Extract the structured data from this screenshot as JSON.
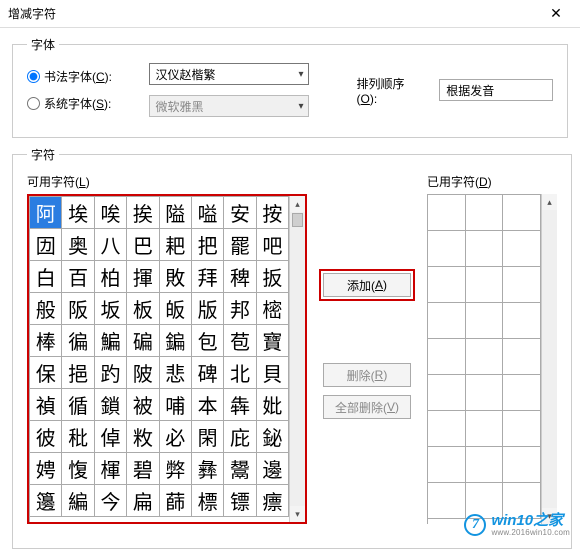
{
  "window": {
    "title": "增减字符",
    "close": "✕"
  },
  "font_group": {
    "legend": "字体",
    "calligraphy": {
      "label_pre": "书法字体(",
      "label_key": "C",
      "label_post": "):"
    },
    "system": {
      "label_pre": "系统字体(",
      "label_key": "S",
      "label_post": "):"
    },
    "calligraphy_value": "汉仪赵楷繁",
    "system_value": "微软雅黑",
    "sort_label_pre": "排列顺序(",
    "sort_label_key": "O",
    "sort_label_post": "):",
    "sort_value": "根据发音"
  },
  "char_group": {
    "legend": "字符",
    "available_pre": "可用字符(",
    "available_key": "L",
    "available_post": ")",
    "used_pre": "已用字符(",
    "used_key": "D",
    "used_post": ")"
  },
  "buttons": {
    "add_pre": "添加(",
    "add_key": "A",
    "add_post": ")",
    "delete_pre": "删除(",
    "delete_key": "R",
    "delete_post": ")",
    "delete_all_pre": "全部删除(",
    "delete_all_key": "V",
    "delete_all_post": ")"
  },
  "watermark": {
    "badge": "7",
    "main": "win10之家",
    "sub": "www.2016win10.com"
  },
  "grid": {
    "selected_index": 0,
    "chars": [
      "阿",
      "埃",
      "唉",
      "挨",
      "隘",
      "嗌",
      "安",
      "按",
      "㘞",
      "奥",
      "八",
      "巴",
      "耙",
      "把",
      "罷",
      "吧",
      "白",
      "百",
      "柏",
      "揮",
      "敗",
      "拜",
      "稗",
      "扳",
      "般",
      "阪",
      "坂",
      "板",
      "皈",
      "版",
      "邦",
      "樒",
      "棒",
      "徧",
      "鯿",
      "碥",
      "鍽",
      "包",
      "苞",
      "寶",
      "保",
      "挹",
      "趵",
      "陂",
      "悲",
      "碑",
      "北",
      "貝",
      "禎",
      "循",
      "鎖",
      "被",
      "哺",
      "本",
      "犇",
      "妣",
      "彼",
      "秕",
      "倬",
      "敉",
      "必",
      "閑",
      "庇",
      "鉍",
      "娉",
      "愎",
      "楎",
      "碧",
      "弊",
      "彝",
      "鬹",
      "邊",
      "籩",
      "編",
      "今",
      "扁",
      "蒒",
      "標",
      "镖",
      "瘭"
    ]
  }
}
